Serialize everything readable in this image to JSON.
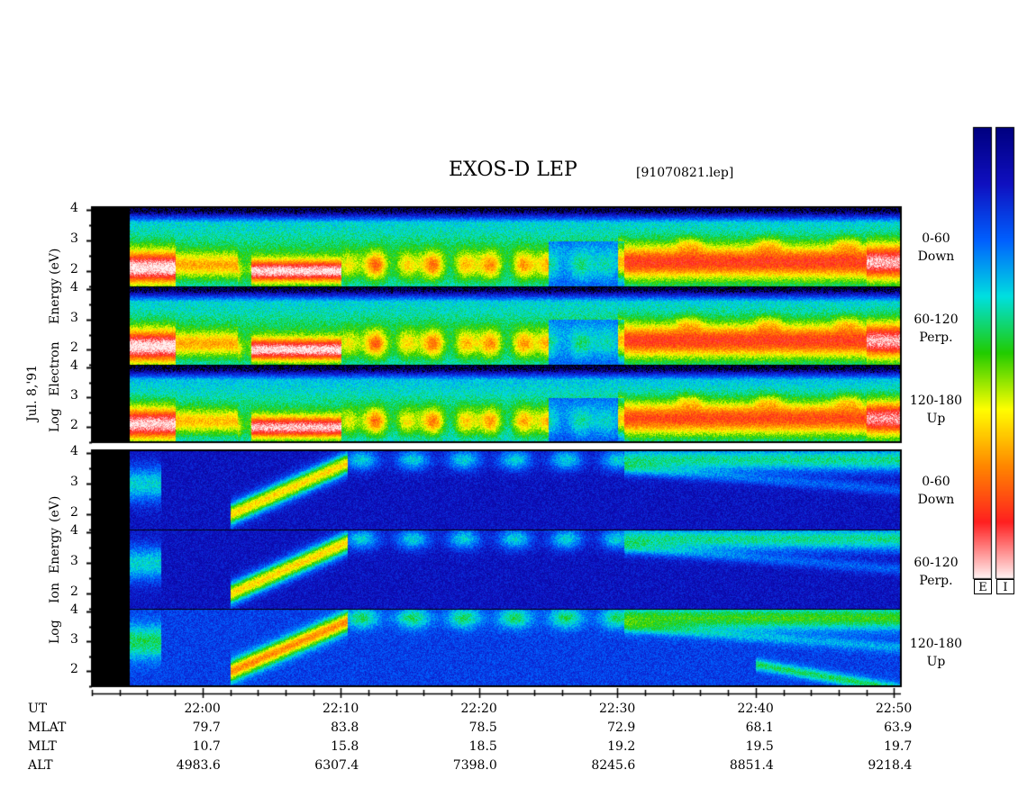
{
  "header": {
    "title": "EXOS-D LEP",
    "file": "[91070821.lep]"
  },
  "date_label": "Jul. 8,'91",
  "colorbar": {
    "electron_label": "E",
    "ion_label": "I"
  },
  "electron_group": {
    "ylabel_parts": [
      "Log",
      "Electron",
      "Energy",
      "(eV)"
    ],
    "panels": [
      {
        "angle": "0-60",
        "direction": "Down"
      },
      {
        "angle": "60-120",
        "direction": "Perp."
      },
      {
        "angle": "120-180",
        "direction": "Up"
      }
    ]
  },
  "ion_group": {
    "ylabel_parts": [
      "Log",
      "Ion",
      "Energy",
      "(eV)"
    ],
    "panels": [
      {
        "angle": "0-60",
        "direction": "Down"
      },
      {
        "angle": "60-120",
        "direction": "Perp."
      },
      {
        "angle": "120-180",
        "direction": "Up"
      }
    ]
  },
  "chart_data": {
    "type": "heatmap",
    "title": "EXOS-D LEP",
    "y_ticks": [
      "2",
      "3",
      "4"
    ],
    "y_range": [
      1.5,
      4.1
    ],
    "time_range_min": [
      1312,
      1370.5
    ],
    "x_ticks": [
      "22:00",
      "22:10",
      "22:20",
      "22:30",
      "22:40",
      "22:50"
    ],
    "x_tick_minutes": [
      1320,
      1330,
      1340,
      1350,
      1360,
      1370
    ],
    "no_data_until_min": 1315,
    "ephemeris": {
      "rows": [
        {
          "name": "UT",
          "values": []
        },
        {
          "name": "MLAT",
          "values": [
            "79.7",
            "83.8",
            "78.5",
            "72.9",
            "68.1",
            "63.9"
          ]
        },
        {
          "name": "MLT",
          "values": [
            "10.7",
            "15.8",
            "18.5",
            "19.2",
            "19.5",
            "19.7"
          ]
        },
        {
          "name": "ALT",
          "values": [
            "4983.6",
            "6307.4",
            "7398.0",
            "8245.6",
            "8851.4",
            "9218.4"
          ]
        }
      ]
    },
    "colors": {
      "colormap": [
        "#fff4f4",
        "#ff2020",
        "#ff8800",
        "#ffff00",
        "#22cc00",
        "#00e0e0",
        "#0060ff",
        "#1010c0",
        "#000080"
      ]
    }
  }
}
